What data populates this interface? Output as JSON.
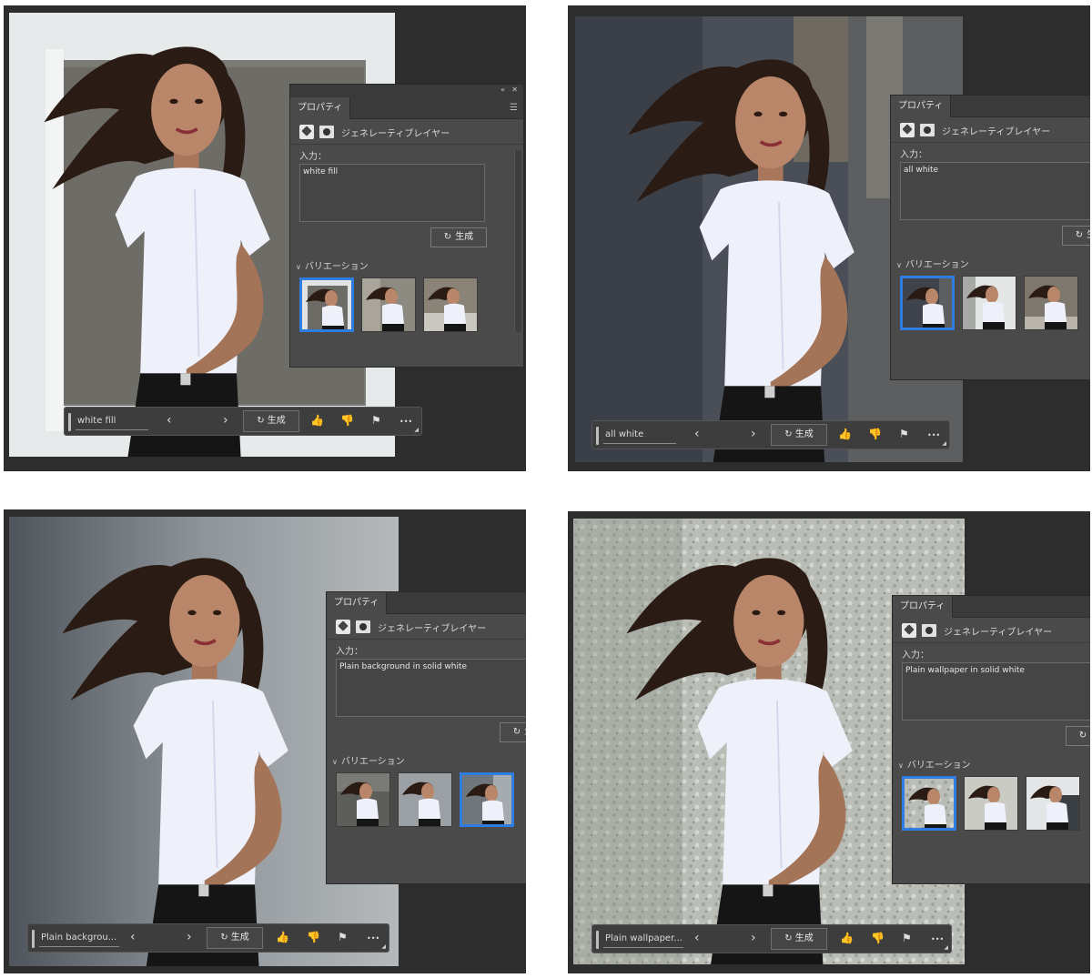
{
  "colors": {
    "app_bg": "#2d2d2d",
    "panel_bg": "#4a4a4a",
    "selected_border": "#2f7de1"
  },
  "icons": [
    "brush-icon",
    "mask-icon",
    "refresh-icon",
    "chevron-left-icon",
    "chevron-right-icon",
    "thumbs-up-icon",
    "thumbs-down-icon",
    "flag-icon",
    "more-icon",
    "collapse-icon",
    "close-icon",
    "panel-menu-icon"
  ],
  "panels": [
    {
      "tab": "プロパティ",
      "layer": "ジェネレーティブレイヤー",
      "input_label": "入力：",
      "prompt": "white fill",
      "generate": "生成",
      "variations": "バリエーション",
      "selected_variation": 1
    },
    {
      "tab": "プロパティ",
      "layer": "ジェネレーティブレイヤー",
      "input_label": "入力：",
      "prompt": "all white",
      "generate": "生成",
      "variations": "バリエーション",
      "selected_variation": 1
    },
    {
      "tab": "プロパティ",
      "layer": "ジェネレーティブレイヤー",
      "input_label": "入力：",
      "prompt": "Plain background in solid white",
      "generate": "生成",
      "variations": "バリエーション",
      "selected_variation": 3
    },
    {
      "tab": "プロパティ",
      "layer": "ジェネレーティブレイヤー",
      "input_label": "入力：",
      "prompt": "Plain wallpaper in solid white",
      "generate": "生成",
      "variations": "バリエーション",
      "selected_variation": 1
    }
  ],
  "taskbars": [
    {
      "text": "white fill",
      "generate": "生成",
      "prev": "‹",
      "next": "›",
      "more": "•••"
    },
    {
      "text": "all white",
      "generate": "生成",
      "prev": "‹",
      "next": "›",
      "more": "•••"
    },
    {
      "text": "Plain backgrou...",
      "generate": "生成",
      "prev": "‹",
      "next": "›",
      "more": "•••"
    },
    {
      "text": "Plain wallpaper...",
      "generate": "生成",
      "prev": "‹",
      "next": "›",
      "more": "•••"
    }
  ],
  "glyphs": {
    "collapse": "«",
    "close": "✕",
    "menu": "☰",
    "refresh": "↻",
    "chevron": "∨",
    "thumbs_up": "👍",
    "thumbs_down": "👎",
    "flag": "⚑"
  }
}
